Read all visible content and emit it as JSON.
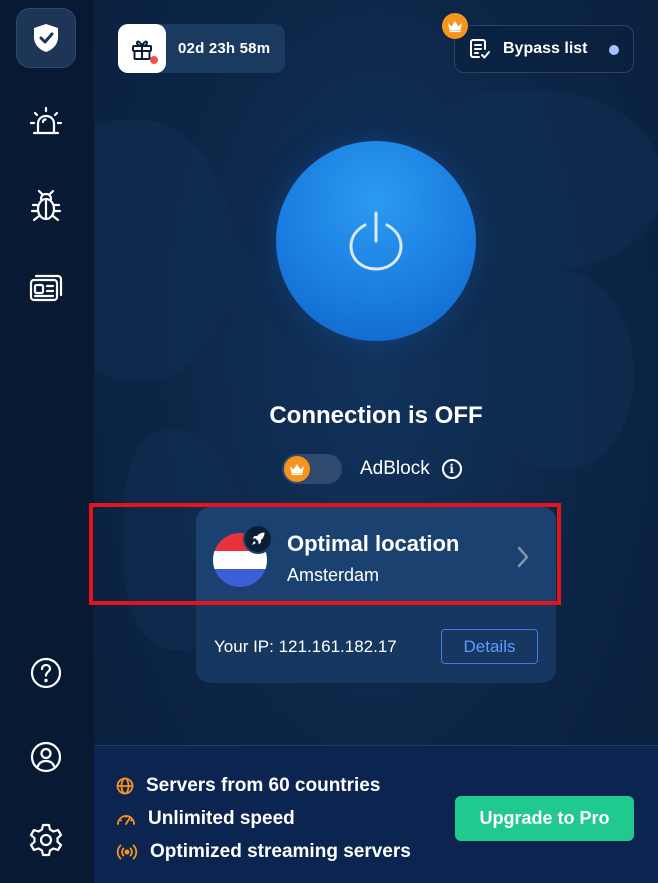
{
  "sidebar": {
    "items": [
      {
        "icon": "shield-check-icon",
        "active": true
      },
      {
        "icon": "alarm-icon",
        "active": false
      },
      {
        "icon": "bug-icon",
        "active": false
      },
      {
        "icon": "id-card-icon",
        "active": false
      }
    ],
    "bottom_items": [
      {
        "icon": "help-icon"
      },
      {
        "icon": "user-icon"
      },
      {
        "icon": "gear-icon"
      }
    ]
  },
  "header": {
    "timer": "02d 23h 58m",
    "bypass_label": "Bypass list"
  },
  "connection": {
    "status_text": "Connection is OFF"
  },
  "adblock": {
    "label": "AdBlock",
    "enabled": false,
    "info_glyph": "i"
  },
  "location": {
    "title": "Optimal location",
    "city": "Amsterdam",
    "ip_text": "Your IP: 121.161.182.17",
    "details_label": "Details"
  },
  "promo": {
    "features": [
      {
        "icon": "globe-icon",
        "text": "Servers from 60 countries"
      },
      {
        "icon": "speedometer-icon",
        "text": "Unlimited speed"
      },
      {
        "icon": "broadcast-icon",
        "text": "Optimized streaming servers"
      }
    ],
    "upgrade_label": "Upgrade to Pro"
  },
  "colors": {
    "background": "#0a1f3d",
    "sidebar": "#081a33",
    "power_button": "#1a7ee0",
    "premium_orange": "#f7941d",
    "upgrade_green": "#20c990",
    "highlight_red": "#e3151a",
    "details_blue": "#3f7ce6"
  }
}
